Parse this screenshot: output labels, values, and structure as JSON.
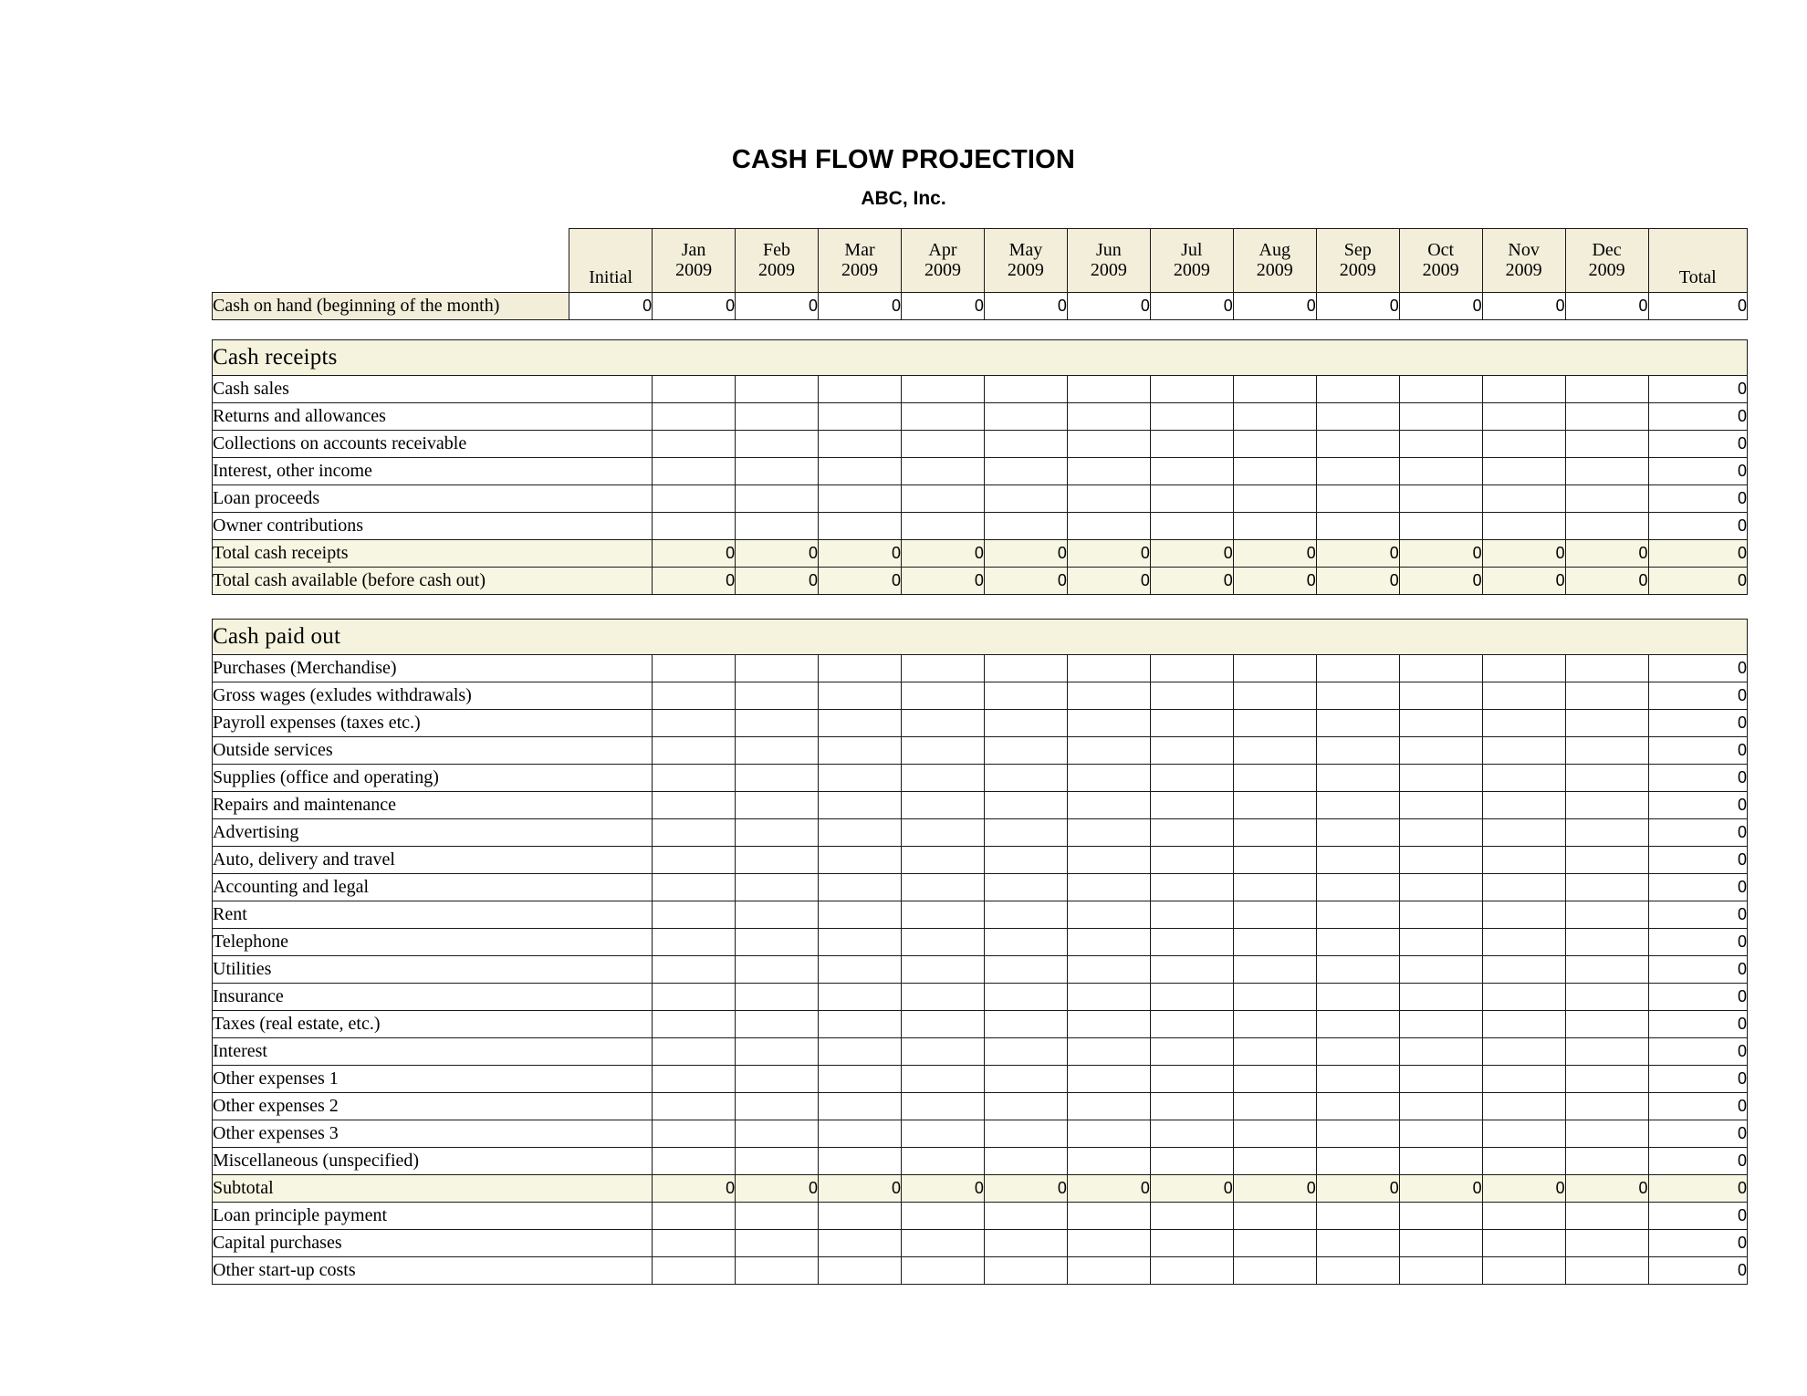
{
  "document": {
    "title": "CASH FLOW PROJECTION",
    "company": "ABC, Inc."
  },
  "columns": {
    "label_header": "",
    "initial": "Initial",
    "months": [
      {
        "name": "Jan",
        "year": "2009"
      },
      {
        "name": "Feb",
        "year": "2009"
      },
      {
        "name": "Mar",
        "year": "2009"
      },
      {
        "name": "Apr",
        "year": "2009"
      },
      {
        "name": "May",
        "year": "2009"
      },
      {
        "name": "Jun",
        "year": "2009"
      },
      {
        "name": "Jul",
        "year": "2009"
      },
      {
        "name": "Aug",
        "year": "2009"
      },
      {
        "name": "Sep",
        "year": "2009"
      },
      {
        "name": "Oct",
        "year": "2009"
      },
      {
        "name": "Nov",
        "year": "2009"
      },
      {
        "name": "Dec",
        "year": "2009"
      }
    ],
    "total": "Total"
  },
  "cash_on_hand": {
    "label": "Cash on hand (beginning of the month)",
    "initial": "0",
    "months": [
      "0",
      "0",
      "0",
      "0",
      "0",
      "0",
      "0",
      "0",
      "0",
      "0",
      "0",
      "0"
    ],
    "total": "0"
  },
  "sections": [
    {
      "id": "cash-receipts",
      "title": "Cash receipts",
      "rows": [
        {
          "label": "Cash sales",
          "style": "plain",
          "months": [
            "",
            "",
            "",
            "",
            "",
            "",
            "",
            "",
            "",
            "",
            "",
            ""
          ],
          "total": "0"
        },
        {
          "label": "Returns and allowances",
          "style": "plain",
          "months": [
            "",
            "",
            "",
            "",
            "",
            "",
            "",
            "",
            "",
            "",
            "",
            ""
          ],
          "total": "0"
        },
        {
          "label": "Collections on accounts receivable",
          "style": "plain",
          "months": [
            "",
            "",
            "",
            "",
            "",
            "",
            "",
            "",
            "",
            "",
            "",
            ""
          ],
          "total": "0"
        },
        {
          "label": "Interest, other income",
          "style": "plain",
          "months": [
            "",
            "",
            "",
            "",
            "",
            "",
            "",
            "",
            "",
            "",
            "",
            ""
          ],
          "total": "0"
        },
        {
          "label": "Loan proceeds",
          "style": "plain",
          "months": [
            "",
            "",
            "",
            "",
            "",
            "",
            "",
            "",
            "",
            "",
            "",
            ""
          ],
          "total": "0"
        },
        {
          "label": "Owner contributions",
          "style": "plain",
          "months": [
            "",
            "",
            "",
            "",
            "",
            "",
            "",
            "",
            "",
            "",
            "",
            ""
          ],
          "total": "0"
        },
        {
          "label": "Total cash receipts",
          "style": "total",
          "months": [
            "0",
            "0",
            "0",
            "0",
            "0",
            "0",
            "0",
            "0",
            "0",
            "0",
            "0",
            "0"
          ],
          "total": "0"
        },
        {
          "label": "Total cash available (before cash out)",
          "style": "total",
          "months": [
            "0",
            "0",
            "0",
            "0",
            "0",
            "0",
            "0",
            "0",
            "0",
            "0",
            "0",
            "0"
          ],
          "total": "0"
        }
      ]
    },
    {
      "id": "cash-paid-out",
      "title": "Cash paid out",
      "rows": [
        {
          "label": "Purchases (Merchandise)",
          "style": "plain",
          "months": [
            "",
            "",
            "",
            "",
            "",
            "",
            "",
            "",
            "",
            "",
            "",
            ""
          ],
          "total": "0"
        },
        {
          "label": "Gross wages (exludes withdrawals)",
          "style": "plain",
          "months": [
            "",
            "",
            "",
            "",
            "",
            "",
            "",
            "",
            "",
            "",
            "",
            ""
          ],
          "total": "0"
        },
        {
          "label": "Payroll expenses (taxes etc.)",
          "style": "plain",
          "months": [
            "",
            "",
            "",
            "",
            "",
            "",
            "",
            "",
            "",
            "",
            "",
            ""
          ],
          "total": "0"
        },
        {
          "label": "Outside services",
          "style": "plain",
          "months": [
            "",
            "",
            "",
            "",
            "",
            "",
            "",
            "",
            "",
            "",
            "",
            ""
          ],
          "total": "0"
        },
        {
          "label": "Supplies (office and operating)",
          "style": "plain",
          "months": [
            "",
            "",
            "",
            "",
            "",
            "",
            "",
            "",
            "",
            "",
            "",
            ""
          ],
          "total": "0"
        },
        {
          "label": "Repairs and maintenance",
          "style": "plain",
          "months": [
            "",
            "",
            "",
            "",
            "",
            "",
            "",
            "",
            "",
            "",
            "",
            ""
          ],
          "total": "0"
        },
        {
          "label": "Advertising",
          "style": "plain",
          "months": [
            "",
            "",
            "",
            "",
            "",
            "",
            "",
            "",
            "",
            "",
            "",
            ""
          ],
          "total": "0"
        },
        {
          "label": "Auto, delivery and travel",
          "style": "plain",
          "months": [
            "",
            "",
            "",
            "",
            "",
            "",
            "",
            "",
            "",
            "",
            "",
            ""
          ],
          "total": "0"
        },
        {
          "label": "Accounting and legal",
          "style": "plain",
          "months": [
            "",
            "",
            "",
            "",
            "",
            "",
            "",
            "",
            "",
            "",
            "",
            ""
          ],
          "total": "0"
        },
        {
          "label": "Rent",
          "style": "plain",
          "months": [
            "",
            "",
            "",
            "",
            "",
            "",
            "",
            "",
            "",
            "",
            "",
            ""
          ],
          "total": "0"
        },
        {
          "label": "Telephone",
          "style": "plain",
          "months": [
            "",
            "",
            "",
            "",
            "",
            "",
            "",
            "",
            "",
            "",
            "",
            ""
          ],
          "total": "0"
        },
        {
          "label": "Utilities",
          "style": "plain",
          "months": [
            "",
            "",
            "",
            "",
            "",
            "",
            "",
            "",
            "",
            "",
            "",
            ""
          ],
          "total": "0"
        },
        {
          "label": "Insurance",
          "style": "plain",
          "months": [
            "",
            "",
            "",
            "",
            "",
            "",
            "",
            "",
            "",
            "",
            "",
            ""
          ],
          "total": "0"
        },
        {
          "label": "Taxes (real estate, etc.)",
          "style": "plain",
          "months": [
            "",
            "",
            "",
            "",
            "",
            "",
            "",
            "",
            "",
            "",
            "",
            ""
          ],
          "total": "0"
        },
        {
          "label": "Interest",
          "style": "plain",
          "months": [
            "",
            "",
            "",
            "",
            "",
            "",
            "",
            "",
            "",
            "",
            "",
            ""
          ],
          "total": "0"
        },
        {
          "label": "Other expenses 1",
          "style": "plain",
          "months": [
            "",
            "",
            "",
            "",
            "",
            "",
            "",
            "",
            "",
            "",
            "",
            ""
          ],
          "total": "0"
        },
        {
          "label": "Other expenses 2",
          "style": "plain",
          "months": [
            "",
            "",
            "",
            "",
            "",
            "",
            "",
            "",
            "",
            "",
            "",
            ""
          ],
          "total": "0"
        },
        {
          "label": "Other expenses 3",
          "style": "plain",
          "months": [
            "",
            "",
            "",
            "",
            "",
            "",
            "",
            "",
            "",
            "",
            "",
            ""
          ],
          "total": "0"
        },
        {
          "label": "Miscellaneous (unspecified)",
          "style": "plain",
          "months": [
            "",
            "",
            "",
            "",
            "",
            "",
            "",
            "",
            "",
            "",
            "",
            ""
          ],
          "total": "0"
        },
        {
          "label": "Subtotal",
          "style": "total",
          "months": [
            "0",
            "0",
            "0",
            "0",
            "0",
            "0",
            "0",
            "0",
            "0",
            "0",
            "0",
            "0"
          ],
          "total": "0"
        },
        {
          "label": "Loan principle payment",
          "style": "plain",
          "months": [
            "",
            "",
            "",
            "",
            "",
            "",
            "",
            "",
            "",
            "",
            "",
            ""
          ],
          "total": "0"
        },
        {
          "label": "Capital purchases",
          "style": "plain",
          "months": [
            "",
            "",
            "",
            "",
            "",
            "",
            "",
            "",
            "",
            "",
            "",
            ""
          ],
          "total": "0"
        },
        {
          "label": "Other start-up costs",
          "style": "plain",
          "months": [
            "",
            "",
            "",
            "",
            "",
            "",
            "",
            "",
            "",
            "",
            "",
            ""
          ],
          "total": "0"
        }
      ]
    }
  ],
  "colors": {
    "header_fill": "#f2eeda",
    "section_fill": "#f5f2dd",
    "total_fill": "#f7f6e2",
    "grid_line": "#1a1a1a",
    "page_background": "#ffffff"
  }
}
